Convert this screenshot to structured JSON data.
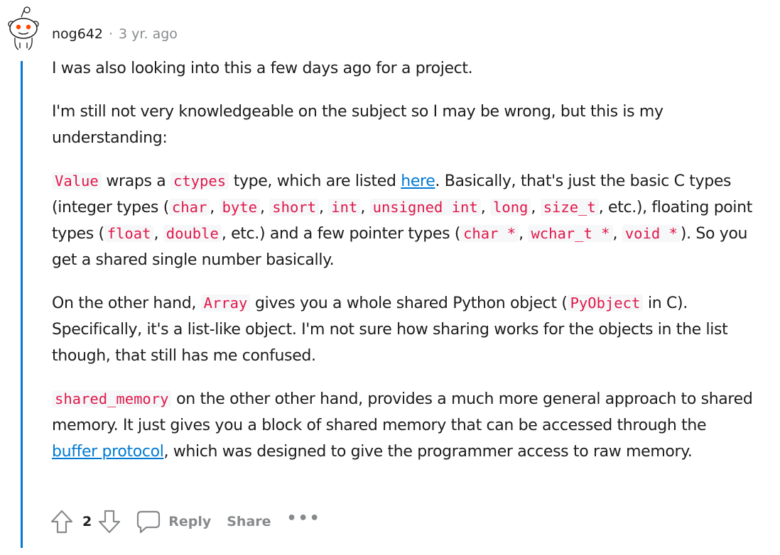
{
  "comment": {
    "username": "nog642",
    "separator": "·",
    "timestamp": "3 yr. ago",
    "paragraphs": {
      "p1": "I was also looking into this a few days ago for a project.",
      "p2": "I'm still not very knowledgeable on the subject so I may be wrong, but this is my understanding:",
      "p3": {
        "code_value": "Value",
        "t1": " wraps a ",
        "code_ctypes": "ctypes",
        "t2": " type, which are listed ",
        "link_here": "here",
        "t3": ". Basically, that's just the basic C types (integer types (",
        "code_char": "char",
        "sep": ", ",
        "code_byte": "byte",
        "code_short": "short",
        "code_int": "int",
        "code_unsigned_int": "unsigned int",
        "code_long": "long",
        "code_size_t": "size_t",
        "t4": ", etc.), floating point types (",
        "code_float": "float",
        "code_double": "double",
        "t5": ", etc.) and a few pointer types (",
        "code_char_ptr": "char *",
        "code_wchar_ptr": "wchar_t *",
        "code_void_ptr": "void *",
        "t6": "). So you get a shared single number basically."
      },
      "p4": {
        "t1": "On the other hand, ",
        "code_array": "Array",
        "t2": " gives you a whole shared Python object (",
        "code_pyobject": "PyObject",
        "t3": " in C). Specifically, it's a list-like object. I'm not sure how sharing works for the objects in the list though, that still has me confused."
      },
      "p5": {
        "code_shared_memory": "shared_memory",
        "t1": " on the other other hand, provides a much more general approach to shared memory. It just gives you a block of shared memory that can be accessed through the ",
        "link_buffer": "buffer protocol",
        "t2": ", which was designed to give the programmer access to raw memory."
      }
    },
    "actions": {
      "score": "2",
      "reply_label": "Reply",
      "share_label": "Share",
      "more_label": "•••"
    }
  },
  "colors": {
    "thread_line": "#0079d3",
    "link": "#0079d3",
    "code_text": "#e0174a",
    "code_bg": "#f6f7f8",
    "muted": "#878a8c"
  },
  "icons": [
    "snoo-avatar-icon",
    "upvote-icon",
    "downvote-icon",
    "comment-bubble-icon"
  ]
}
